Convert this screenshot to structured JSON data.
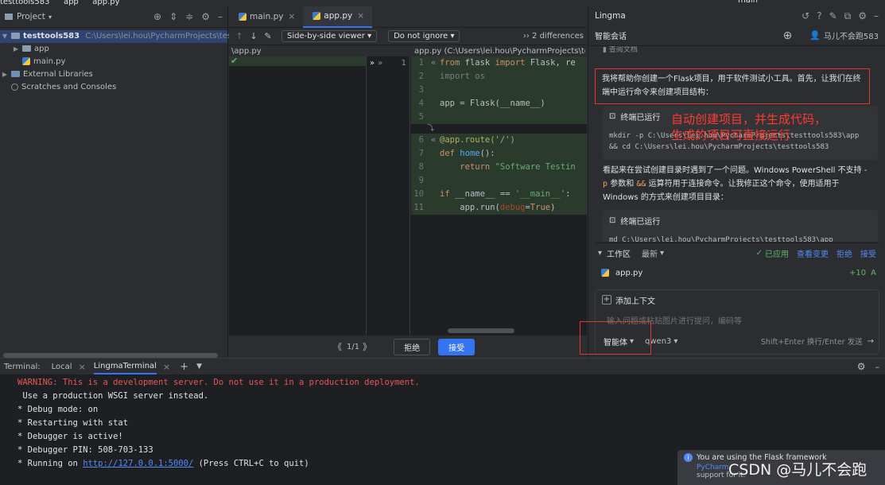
{
  "top_strip": {
    "project_name": "testtools583",
    "crumb_app": "app",
    "crumb_file": "app.py",
    "branch": "main"
  },
  "project_panel": {
    "title": "Project",
    "tree": [
      {
        "label": "testtools583",
        "path": "C:\\Users\\lei.hou\\PycharmProjects\\testtools5"
      },
      {
        "label": "app"
      },
      {
        "label": "main.py"
      },
      {
        "label": "External Libraries"
      },
      {
        "label": "Scratches and Consoles"
      }
    ]
  },
  "editor": {
    "tabs": [
      {
        "label": "main.py"
      },
      {
        "label": "app.py"
      }
    ],
    "viewer_mode": "Side-by-side viewer",
    "ignore_mode": "Do not ignore",
    "differences": "2 differences",
    "left_path": "\\app.py",
    "right_path": "app.py (C:\\Users\\lei.hou\\PycharmProjects\\test...",
    "left_line_no": "1",
    "code_lines": [
      {
        "n": "1",
        "text": "from flask import Flask, re"
      },
      {
        "n": "2",
        "text": "import os"
      },
      {
        "n": "3",
        "text": ""
      },
      {
        "n": "4",
        "text": "app = Flask(__name__)"
      },
      {
        "n": "5",
        "text": ""
      },
      {
        "n": "6",
        "text": "@app.route('/')"
      },
      {
        "n": "7",
        "text": "def home():"
      },
      {
        "n": "8",
        "text": "    return \"Software Testin"
      },
      {
        "n": "9",
        "text": ""
      },
      {
        "n": "10",
        "text": "if __name__ == '__main__':"
      },
      {
        "n": "11",
        "text": "    app.run(debug=True)"
      }
    ],
    "collapsed_marker": "⤵",
    "pager": "1/1",
    "reject": "拒绝",
    "accept": "接受"
  },
  "lingma": {
    "title": "Lingma",
    "chat_label": "智能会话",
    "user": "马儿不会跑583",
    "partial_top": "查阅文档",
    "msg1": "我将帮助你创建一个Flask项目，用于软件测试小工具。首先，让我们在终端中运行命令来创建项目结构：",
    "term_done": "终端已运行",
    "term_cmd1": "mkdir -p C:\\Users\\lei.hou\\PycharmProjects\\testtools583\\app",
    "term_cmd2": "&& cd C:\\Users\\lei.hou\\PycharmProjects\\testtools583",
    "annotation1_line1": "自动创建项目，并生成代码，",
    "annotation1_line2": "生成的项目可直接运行",
    "msg2_a": "看起来在尝试创建目录时遇到了一个问题。Windows PowerShell 不支持 -",
    "msg2_b_code1": "p",
    "msg2_b_mid": " 参数和 ",
    "msg2_b_code2": "&&",
    "msg2_b_end": " 运算符用于连接命令。让我修正这个命令，使用适用于",
    "msg2_c": "Windows 的方式来创建项目目录：",
    "term_cmd3": "md C:\\Users\\lei.hou\\PycharmProjects\\testtools583\\app",
    "workarea_label": "工作区",
    "workarea_filter": "最新",
    "applied": "已应用",
    "view_changes": "查看变更",
    "reject": "拒绝",
    "accept": "接受",
    "changed_file": "app.py",
    "changed_count": "+10",
    "changed_status": "A",
    "add_context": "添加上下文",
    "input_placeholder": "输入问题或粘贴图片进行提问，编码等",
    "mode": "智能体",
    "model": "qwen3",
    "send_hint": "Shift+Enter 换行/Enter 发送",
    "annotation3": "3"
  },
  "terminal": {
    "label": "Terminal:",
    "tabs": [
      {
        "label": "Local"
      },
      {
        "label": "LingmaTerminal"
      }
    ],
    "lines": [
      {
        "text": "WARNING: This is a development server. Do not use it in a production deployment.",
        "color": "#e55757"
      },
      {
        "text": " Use a production WSGI server instead.",
        "color": "#dfe1e5"
      },
      {
        "text": "* Debug mode: on",
        "color": "#dfe1e5"
      },
      {
        "text": "* Restarting with stat",
        "color": "#dfe1e5"
      },
      {
        "text": "* Debugger is active!",
        "color": "#dfe1e5"
      },
      {
        "text": "* Debugger PIN: 508-703-133",
        "color": "#dfe1e5"
      }
    ],
    "running_prefix": "* Running on ",
    "running_url": "http://127.0.0.1:5000/",
    "running_suffix": " (Press CTRL+C to quit)"
  },
  "notification": {
    "title": "You are using the Flask framework",
    "line2": "PyCharm",
    "line3": "support for it."
  },
  "watermark": "CSDN @马儿不会跑"
}
